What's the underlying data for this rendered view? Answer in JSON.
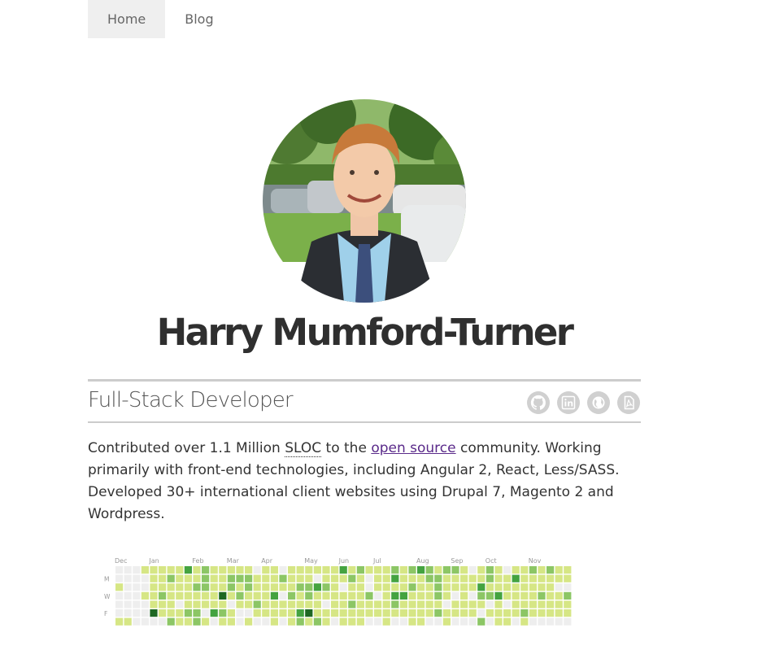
{
  "nav": {
    "items": [
      {
        "label": "Home",
        "active": true
      },
      {
        "label": "Blog",
        "active": false
      }
    ]
  },
  "profile": {
    "name": "Harry Mumford-Turner",
    "role": "Full-Stack Developer",
    "social_icons": [
      "github-icon",
      "linkedin-icon",
      "globe-icon",
      "pdf-icon"
    ],
    "icon_color": "#d0d0d0"
  },
  "bio": {
    "part1": "Contributed over 1.1 Million ",
    "abbr": "SLOC",
    "part2": " to the ",
    "link": "open source",
    "part3": " community. Working primarily with front-end technologies, including Angular 2, React, Less/SASS. Developed 30+ international client websites using Drupal 7, Magento 2 and Wordpress."
  },
  "contributions": {
    "months": [
      "Dec",
      "Jan",
      "Feb",
      "Mar",
      "Apr",
      "May",
      "Jun",
      "Jul",
      "Aug",
      "Sep",
      "Oct",
      "Nov"
    ],
    "day_labels": [
      "M",
      "W",
      "F"
    ],
    "colors": [
      "#eeeeee",
      "#d6e685",
      "#8cc665",
      "#44a340",
      "#1e6823"
    ]
  }
}
